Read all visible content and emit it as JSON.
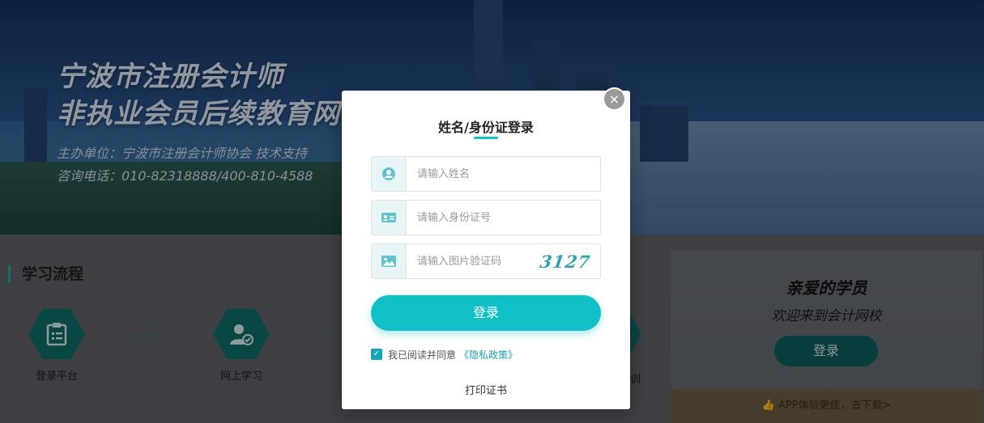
{
  "banner": {
    "title_line1": "宁波市注册会计师",
    "title_line2": "非执业会员后续教育网",
    "organizer": "主办单位：宁波市注册会计师协会    技术支持",
    "phone": "咨询电话：010-82318888/400-810-4588"
  },
  "process": {
    "title": "学习流程",
    "steps": [
      {
        "label": "登录平台",
        "icon": "clipboard-icon"
      },
      {
        "label": "网上学习",
        "icon": "user-check-icon"
      }
    ],
    "partial_label": "训"
  },
  "welcome": {
    "title": "亲爱的学员",
    "subtitle": "欢迎来到会计网校",
    "login_label": "登录",
    "app_promo": "APP体验更佳，去下载>"
  },
  "modal": {
    "title": "姓名/身份证登录",
    "close_icon": "×",
    "name_placeholder": "请输入姓名",
    "id_placeholder": "请输入身份证号",
    "captcha_placeholder": "请输入图片验证码",
    "captcha_text": "3127",
    "login_label": "登录",
    "agree_text": "我已阅读并同意",
    "privacy_link": "《隐私政策》",
    "print_certificate": "打印证书",
    "agree_checked": true
  },
  "colors": {
    "accent": "#11bfc7",
    "icon_bg": "#e7f5f7",
    "icon_fg": "#5fc4cf"
  }
}
